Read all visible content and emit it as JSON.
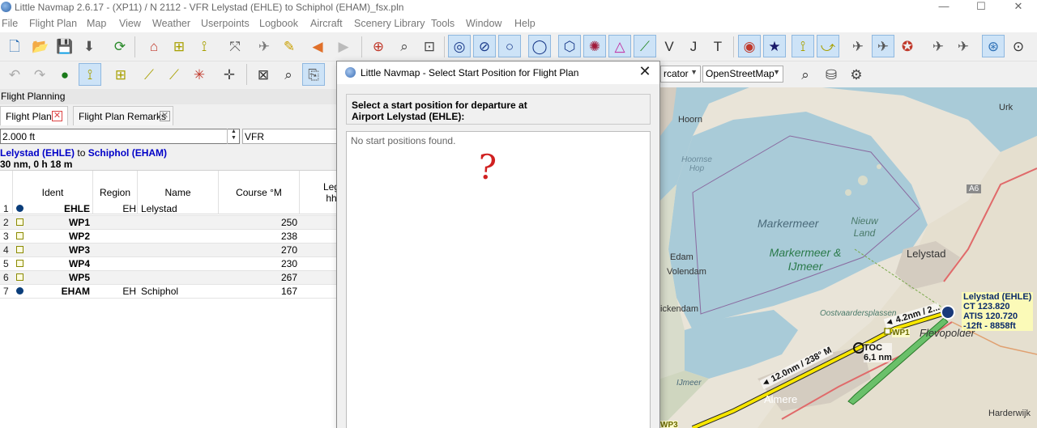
{
  "window": {
    "title": "Little Navmap 2.6.17 - (XP11) / N 2112 - VFR Lelystad (EHLE) to Schiphol (EHAM)_fsx.pln",
    "minimize": "—",
    "maximize": "☐",
    "close": "✕"
  },
  "menu": [
    "File",
    "Flight Plan",
    "Map",
    "View",
    "Weather",
    "Userpoints",
    "Logbook",
    "Aircraft",
    "Scenery Library",
    "Tools",
    "Window",
    "Help"
  ],
  "map_controls": {
    "projection": "rcator",
    "theme": "OpenStreetMap"
  },
  "flight_planning": {
    "dock_title": "Flight Planning",
    "tabs": [
      {
        "label": "Flight Plan",
        "active": true
      },
      {
        "label": "Flight Plan Remarks",
        "active": false
      }
    ],
    "altitude": "2.000 ft",
    "flight_rules": "VFR",
    "route": {
      "departure": "Lelystad (EHLE)",
      "to": "to",
      "destination": "Schiphol (EHAM)",
      "summary": "30 nm, 0 h 18 m"
    },
    "columns": {
      "ident": "Ident",
      "region": "Region",
      "name": "Name",
      "course": "Course °M",
      "leg": "Leg hh:"
    },
    "rows": [
      {
        "num": "1",
        "type": "airport",
        "ident": "EHLE",
        "region": "EH",
        "name": "Lelystad",
        "course": ""
      },
      {
        "num": "2",
        "type": "waypoint",
        "ident": "WP1",
        "region": "",
        "name": "",
        "course": "250"
      },
      {
        "num": "3",
        "type": "waypoint",
        "ident": "WP2",
        "region": "",
        "name": "",
        "course": "238"
      },
      {
        "num": "4",
        "type": "waypoint",
        "ident": "WP3",
        "region": "",
        "name": "",
        "course": "270"
      },
      {
        "num": "5",
        "type": "waypoint",
        "ident": "WP4",
        "region": "",
        "name": "",
        "course": "230"
      },
      {
        "num": "6",
        "type": "waypoint",
        "ident": "WP5",
        "region": "",
        "name": "",
        "course": "267"
      },
      {
        "num": "7",
        "type": "airport",
        "ident": "EHAM",
        "region": "EH",
        "name": "Schiphol",
        "course": "167"
      }
    ]
  },
  "dialog": {
    "title": "Little Navmap - Select Start Position for Flight Plan",
    "header_line1": "Select a start position for departure at",
    "header_line2": "Airport Lelystad (EHLE):",
    "empty_message": "No start positions found.",
    "annotation": "?"
  },
  "map": {
    "labels": {
      "urk": "Urk",
      "hoorn": "Hoorn",
      "hoornse_hop": "Hoornse Hop",
      "markermeer": "Markermeer",
      "markermeer_ijmeer": "Markermeer & IJmeer",
      "nieuw_land": "Nieuw Land",
      "lelystad_city": "Lelystad",
      "edam": "Edam",
      "volendam": "Volendam",
      "monnickendam": "ickendam",
      "oostvaardersplassen": "Oostvaardersplassen",
      "flevopolder": "Flevopolder",
      "ijmeer": "IJmeer",
      "almere": "Almere",
      "harderwijk": "Harderwijk",
      "road_a6": "A6",
      "airport_info": [
        "Lelystad (EHLE)",
        "CT 123.820",
        "ATIS 120.720",
        "-12ft - 8858ft"
      ],
      "leg1": "◄ 4.2nm / 2...",
      "leg2": "◄ 12.0nm / 238° M",
      "toc": "TOC",
      "toc_dist": "6,1 nm",
      "wp1": "WP1",
      "wp3": "WP3"
    },
    "colors": {
      "water": "#a9cbd8",
      "land": "#e9e4d8",
      "route": "#f7e600",
      "green_runway": "#3aa23a"
    }
  }
}
